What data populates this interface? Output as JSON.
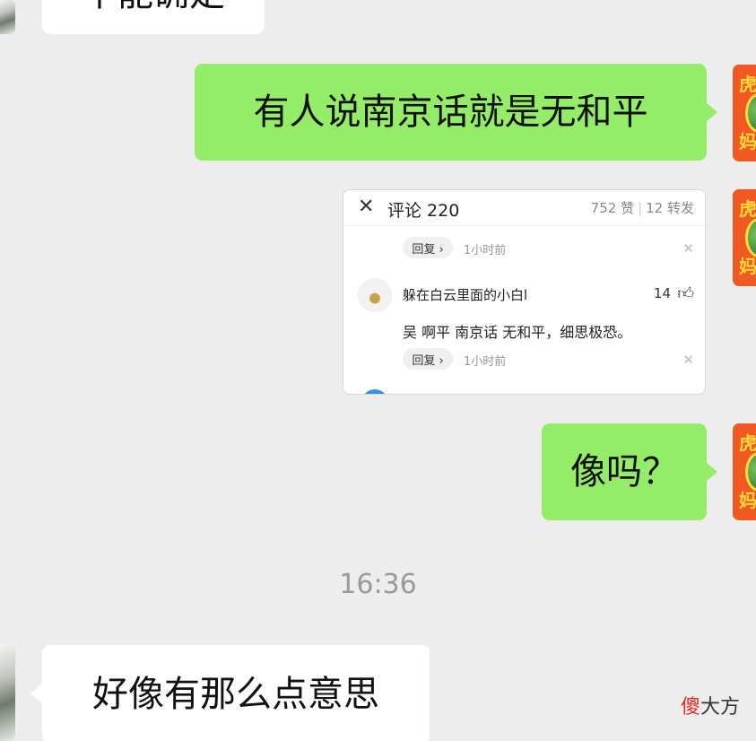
{
  "messages": {
    "top_partial": "不能确定",
    "sent_1": "有人说南京话就是无和平",
    "sent_2": "像吗？",
    "received_1": "好像有那么点意思"
  },
  "timestamp": "16:36",
  "avatar_chars": {
    "top": "虎",
    "bottom": "妈"
  },
  "shared_card": {
    "title": "评论 220",
    "likes": "752 赞",
    "shares": "12 转发",
    "reply_label": "回复 ›",
    "time_ago_1": "1小时前",
    "time_ago_2": "1小时前",
    "username": "躲在白云里面的小白l",
    "like_count": "14",
    "comment_text": "吴 啊平 南京话 无和平，细思极恐。"
  },
  "watermark": {
    "red": "傻",
    "black": "大方"
  },
  "colors": {
    "background": "#ededed",
    "sent_bubble": "#95ec69",
    "received_bubble": "#ffffff",
    "avatar": "#f05a22"
  },
  "icons": [
    "close-icon",
    "thumbs-up-icon",
    "dismiss-icon"
  ]
}
